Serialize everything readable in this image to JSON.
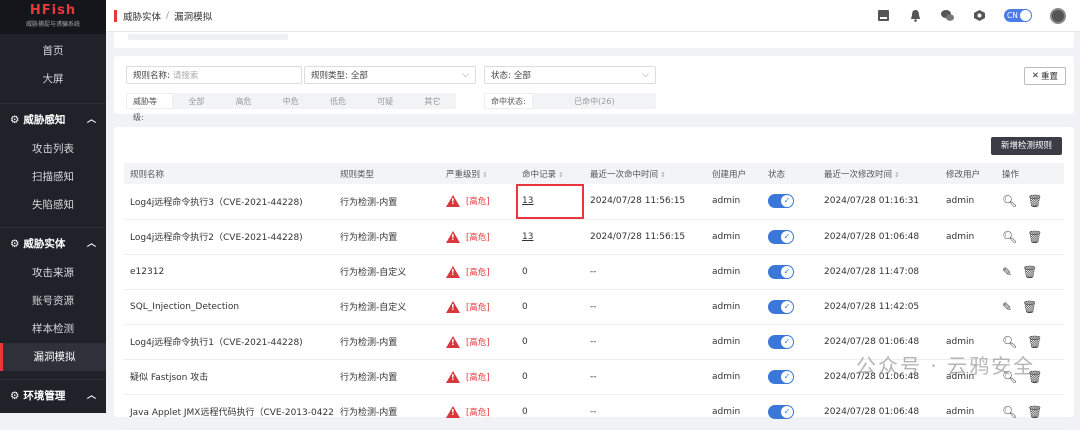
{
  "app": {
    "logo": "HFish",
    "logo_sub": "威胁捕捉与诱骗系统"
  },
  "sidebar": {
    "top_items": [
      {
        "label": "首页"
      },
      {
        "label": "大屏"
      }
    ],
    "groups": [
      {
        "label": "威胁感知",
        "items": [
          {
            "label": "攻击列表"
          },
          {
            "label": "扫描感知"
          },
          {
            "label": "失陷感知"
          }
        ]
      },
      {
        "label": "威胁实体",
        "items": [
          {
            "label": "攻击来源"
          },
          {
            "label": "账号资源"
          },
          {
            "label": "样本检测"
          },
          {
            "label": "漏洞模拟"
          }
        ]
      },
      {
        "label": "环境管理"
      }
    ]
  },
  "header": {
    "breadcrumb": [
      "威胁实体",
      "漏洞模拟"
    ],
    "lang": "CN"
  },
  "filters": {
    "rule_name_label": "规则名称:",
    "rule_name_placeholder": "请搜索",
    "rule_type_label": "规则类型:",
    "rule_type_value": "全部",
    "status_label": "状态:",
    "status_value": "全部",
    "reset_label": "重置",
    "level_label": "威胁等级:",
    "levels": [
      "全部",
      "高危",
      "中危",
      "低危",
      "可疑",
      "其它"
    ],
    "hit_label": "命中状态:",
    "hit_value": "已命中(26)"
  },
  "table": {
    "new_button": "新增检测规则",
    "headers": [
      "规则名称",
      "规则类型",
      "严重级别",
      "命中记录",
      "最近一次命中时间",
      "创建用户",
      "状态",
      "最近一次修改时间",
      "修改用户",
      "操作"
    ],
    "rows": [
      {
        "name": "Log4j远程命令执行3（CVE-2021-44228)",
        "type": "行为检测-内置",
        "severity": "[高危]",
        "hits": "13",
        "last_hit": "2024/07/28 11:56:15",
        "creator": "admin",
        "modified": "2024/07/28 01:16:31",
        "modifier": "admin"
      },
      {
        "name": "Log4j远程命令执行2（CVE-2021-44228)",
        "type": "行为检测-内置",
        "severity": "[高危]",
        "hits": "13",
        "last_hit": "2024/07/28 11:56:15",
        "creator": "admin",
        "modified": "2024/07/28 01:06:48",
        "modifier": "admin"
      },
      {
        "name": "e12312",
        "type": "行为检测-自定义",
        "severity": "[高危]",
        "hits": "0",
        "last_hit": "--",
        "creator": "admin",
        "modified": "2024/07/28 11:47:08",
        "modifier": ""
      },
      {
        "name": "SQL_Injection_Detection",
        "type": "行为检测-自定义",
        "severity": "[高危]",
        "hits": "0",
        "last_hit": "--",
        "creator": "admin",
        "modified": "2024/07/28 11:42:05",
        "modifier": ""
      },
      {
        "name": "Log4j远程命令执行1（CVE-2021-44228)",
        "type": "行为检测-内置",
        "severity": "[高危]",
        "hits": "0",
        "last_hit": "--",
        "creator": "admin",
        "modified": "2024/07/28 01:06:48",
        "modifier": "admin"
      },
      {
        "name": "疑似 Fastjson 攻击",
        "type": "行为检测-内置",
        "severity": "[高危]",
        "hits": "0",
        "last_hit": "--",
        "creator": "admin",
        "modified": "2024/07/28 01:06:48",
        "modifier": "admin"
      },
      {
        "name": "Java Applet JMX远程代码执行（CVE-2013-0422)",
        "type": "行为检测-内置",
        "severity": "[高危]",
        "hits": "0",
        "last_hit": "--",
        "creator": "admin",
        "modified": "2024/07/28 01:06:48",
        "modifier": "admin"
      }
    ]
  },
  "watermark": "公众号 · 云鸦安全"
}
